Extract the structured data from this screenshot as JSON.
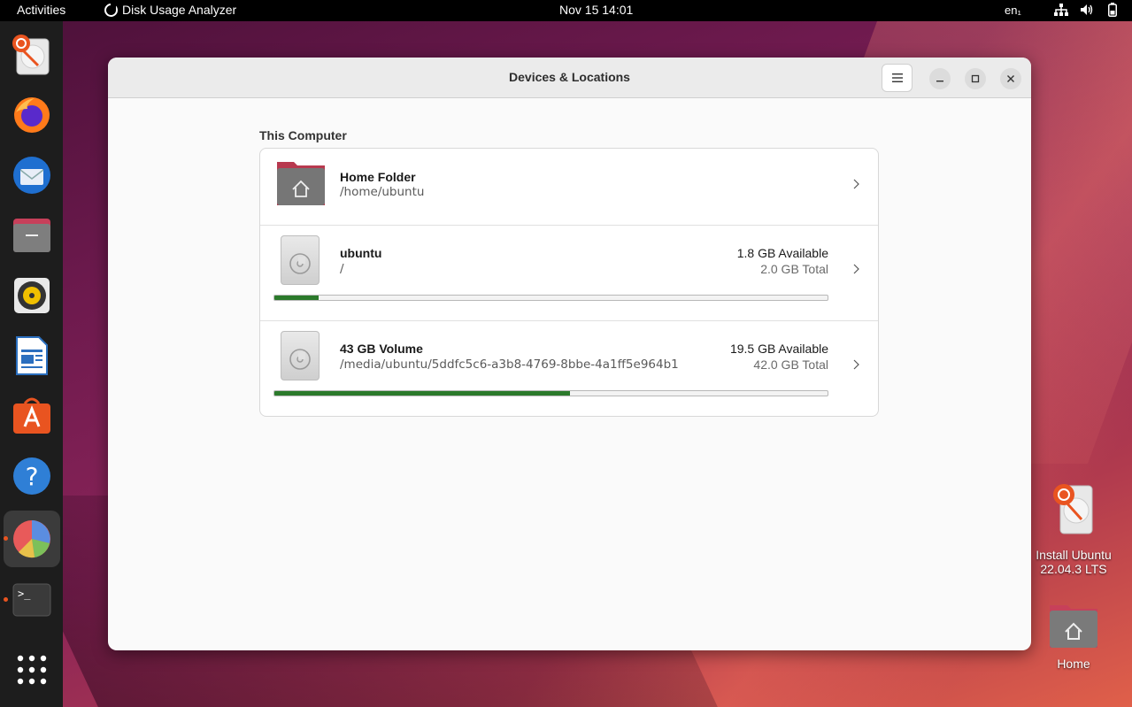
{
  "topbar": {
    "activities": "Activities",
    "app_name": "Disk Usage Analyzer",
    "clock": "Nov 15  14:01",
    "lang": "en₁"
  },
  "dock": {
    "items": [
      {
        "name": "install-ubuntu"
      },
      {
        "name": "firefox"
      },
      {
        "name": "thunderbird"
      },
      {
        "name": "files"
      },
      {
        "name": "rhythmbox"
      },
      {
        "name": "libreoffice-writer"
      },
      {
        "name": "ubuntu-software"
      },
      {
        "name": "help"
      },
      {
        "name": "disk-usage-analyzer"
      },
      {
        "name": "terminal"
      },
      {
        "name": "show-applications"
      }
    ]
  },
  "window": {
    "title": "Devices & Locations",
    "section": "This Computer",
    "rows": [
      {
        "name": "Home Folder",
        "path": "/home/ubuntu"
      },
      {
        "name": "ubuntu",
        "path": "/",
        "available": "1.8 GB Available",
        "total": "2.0 GB Total",
        "used_fraction": 0.08
      },
      {
        "name": "43 GB Volume",
        "path": "/media/ubuntu/5ddfc5c6-a3b8-4769-8bbe-4a1ff5e964b1",
        "available": "19.5 GB Available",
        "total": "42.0 GB Total",
        "used_fraction": 0.535
      }
    ]
  },
  "desktop": {
    "install_label_1": "Install Ubuntu",
    "install_label_2": "22.04.3 LTS",
    "home_label": "Home"
  },
  "colors": {
    "accent": "#e95420",
    "bar_fill": "#2b7a2b"
  }
}
